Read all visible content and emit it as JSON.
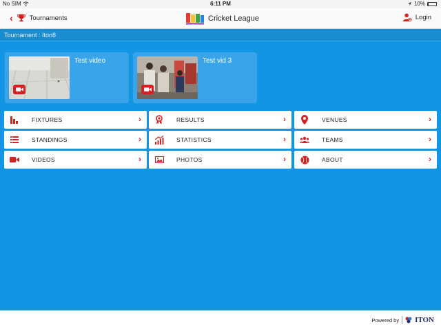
{
  "status_bar": {
    "carrier": "No SIM",
    "wifi_icon": "wifi-icon",
    "time": "6:11 PM",
    "battery_percent": "10%",
    "battery_level": 0.1
  },
  "nav": {
    "back_label": "Tournaments",
    "app_title": "Cricket League",
    "login_label": "Login"
  },
  "subheader": {
    "text": "Tournament : Iton8"
  },
  "videos": [
    {
      "title": "Test video",
      "icon": "video-camera-icon"
    },
    {
      "title": "Test vid 3",
      "icon": "video-camera-icon"
    }
  ],
  "menu": [
    {
      "label": "FIXTURES",
      "icon": "bar-chart-icon"
    },
    {
      "label": "RESULTS",
      "icon": "medal-icon"
    },
    {
      "label": "VENUES",
      "icon": "location-pin-icon"
    },
    {
      "label": "STANDINGS",
      "icon": "list-icon"
    },
    {
      "label": "STATISTICS",
      "icon": "stats-icon"
    },
    {
      "label": "TEAMS",
      "icon": "group-icon"
    },
    {
      "label": "VIDEOS",
      "icon": "video-camera-icon"
    },
    {
      "label": "PHOTOS",
      "icon": "photo-icon"
    },
    {
      "label": "ABOUT",
      "icon": "ball-icon"
    }
  ],
  "footer": {
    "powered_by": "Powered by",
    "brand": "ITON"
  },
  "colors": {
    "accent_red": "#d32020",
    "background_blue": "#1295e3",
    "card_blue": "#3aa4ea"
  }
}
